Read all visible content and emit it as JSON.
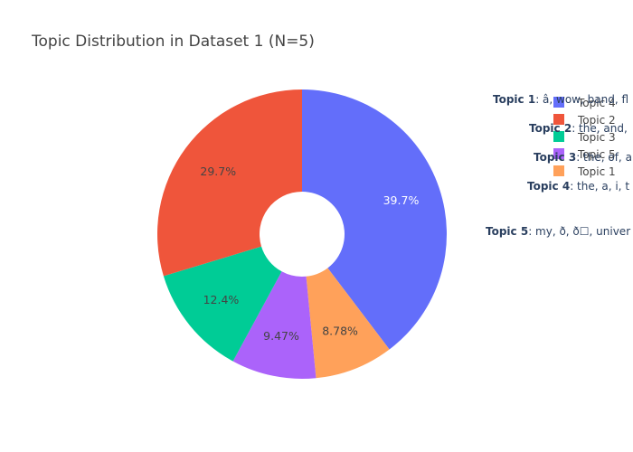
{
  "chart_data": {
    "type": "pie",
    "title": "Topic Distribution in Dataset 1 (N=5)",
    "hole": true,
    "slices": [
      {
        "label": "Topic 4",
        "value": 39.7,
        "text": "39.7%",
        "color": "#636efa",
        "text_color": "#ffffff"
      },
      {
        "label": "Topic 1",
        "value": 8.78,
        "text": "8.78%",
        "color": "#ffa15a",
        "text_color": "#444444"
      },
      {
        "label": "Topic 5",
        "value": 9.47,
        "text": "9.47%",
        "color": "#ab63fa",
        "text_color": "#444444"
      },
      {
        "label": "Topic 3",
        "value": 12.4,
        "text": "12.4%",
        "color": "#00cc96",
        "text_color": "#444444"
      },
      {
        "label": "Topic 2",
        "value": 29.7,
        "text": "29.7%",
        "color": "#ef553b",
        "text_color": "#444444"
      }
    ],
    "legend": {
      "placement": "top-right",
      "entries": [
        "Topic 4",
        "Topic 2",
        "Topic 3",
        "Topic 5",
        "Topic 1"
      ]
    },
    "annotations": [
      {
        "name": "Topic 1",
        "words": ": â, wow, band, fl"
      },
      {
        "name": "Topic 2",
        "words": ": the, and,"
      },
      {
        "name": "Topic 3",
        "words": ": the, of, a"
      },
      {
        "name": "Topic 4",
        "words": ": the, a, i, t"
      },
      {
        "name": "Topic 5",
        "words": ": my, ð, ð☐, univer"
      }
    ]
  }
}
